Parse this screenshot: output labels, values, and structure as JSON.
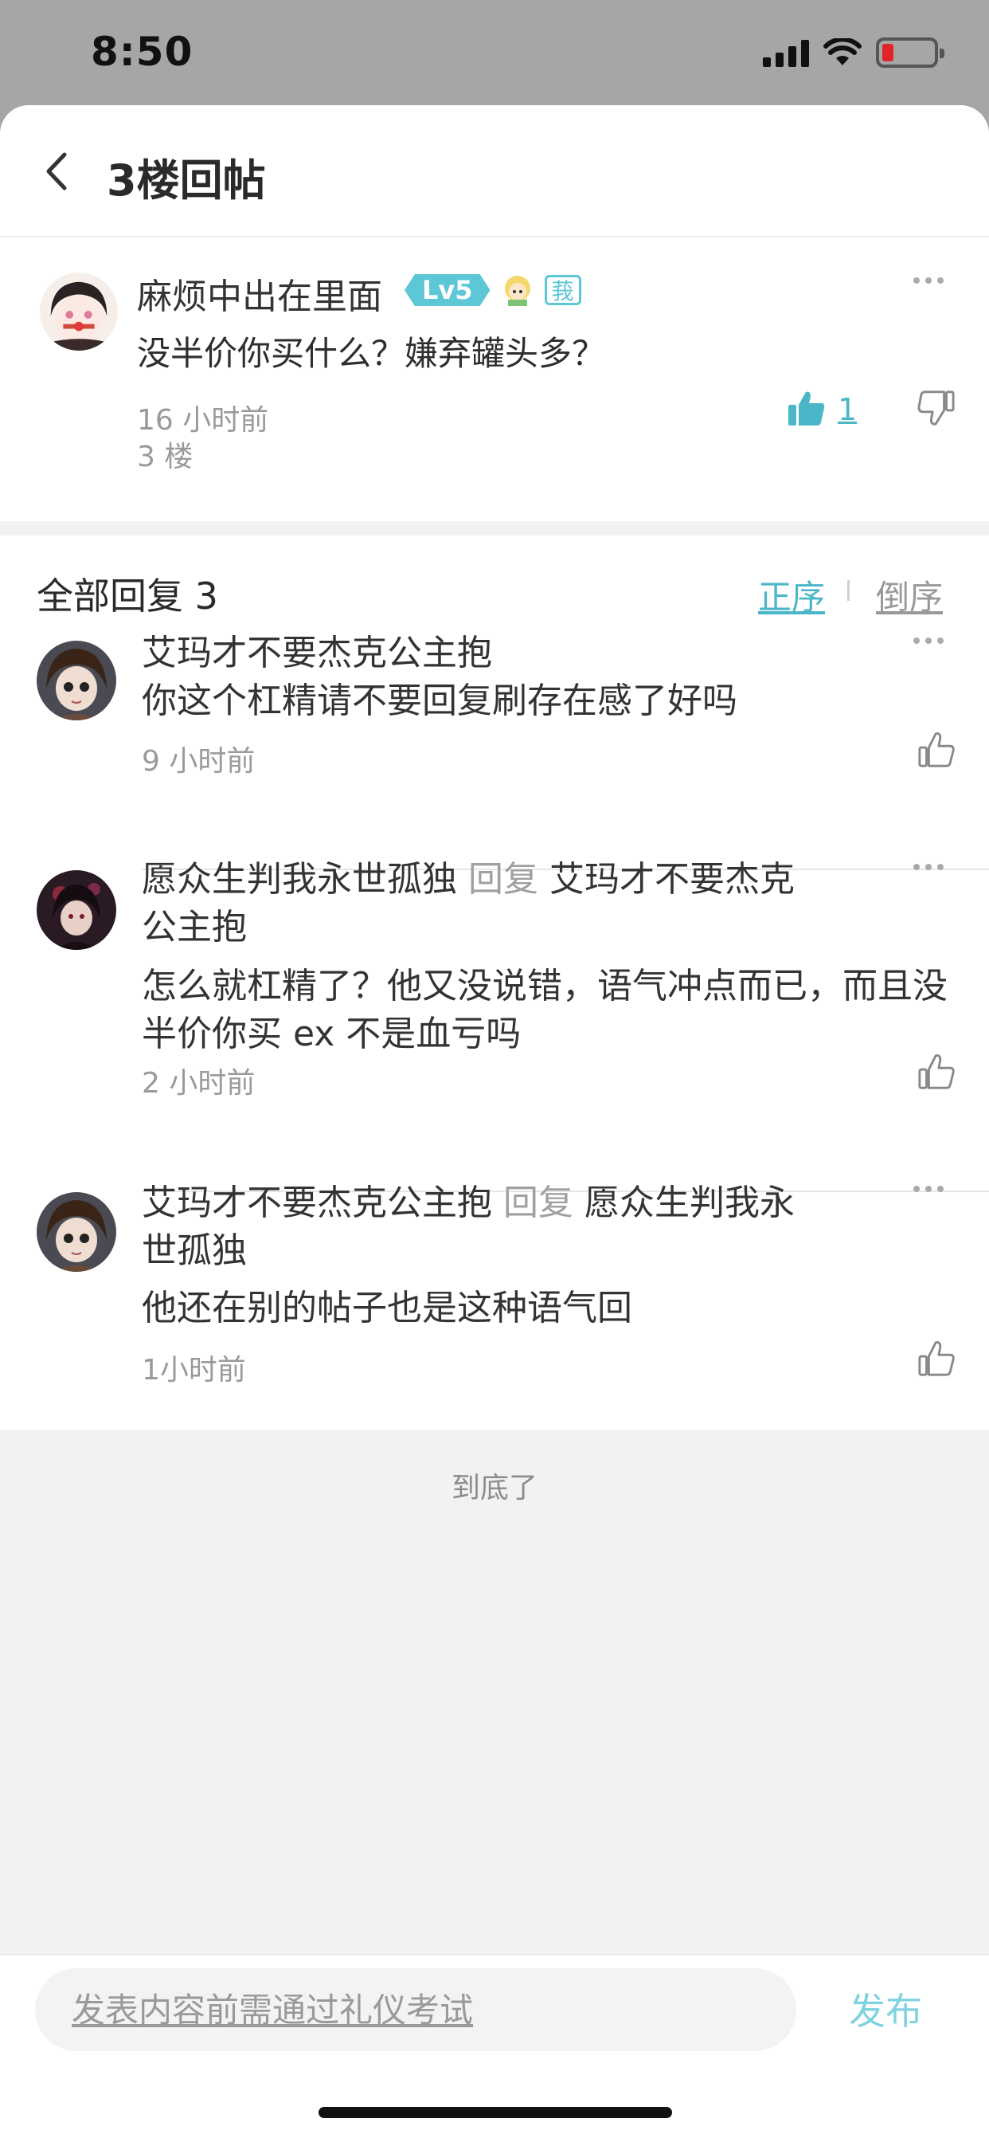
{
  "status_bar": {
    "time": "8:50",
    "battery_color": "#e0242a"
  },
  "header": {
    "title": "3楼回帖"
  },
  "main_post": {
    "username": "麻烦中出在里面",
    "level": "Lv5",
    "tag": "莪",
    "floor": "3 楼",
    "content": "没半价你买什么？嫌弃罐头多？",
    "time": "16 小时前",
    "like_count": "1"
  },
  "replies": {
    "title": "全部回复 3",
    "sort_asc": "正序",
    "sort_desc": "倒序",
    "items": [
      {
        "username": "艾玛才不要杰克公主抱",
        "reply_word": "",
        "reply_to": "",
        "content": "你这个杠精请不要回复刷存在感了好吗",
        "time": "9 小时前"
      },
      {
        "username": "愿众生判我永世孤独",
        "reply_word": "回复",
        "reply_to": "艾玛才不要杰克公主抱",
        "content": "怎么就杠精了？他又没说错，语气冲点而已，而且没半价你买 ex 不是血亏吗",
        "time": "2 小时前"
      },
      {
        "username": "艾玛才不要杰克公主抱",
        "reply_word": "回复",
        "reply_to": "愿众生判我永世孤独",
        "content": "他还在别的帖子也是这种语气回",
        "time": "1小时前"
      }
    ]
  },
  "footer": {
    "end_text": "到底了"
  },
  "bottom_bar": {
    "placeholder": "发表内容前需通过礼仪考试",
    "publish_label": "发布"
  },
  "colors": {
    "accent": "#4bb6c8",
    "level_badge": "#5ec7d6",
    "publish": "#7fd3df"
  },
  "icons": [
    "back-icon",
    "more-icon",
    "thumbs-up-icon",
    "thumbs-down-icon",
    "signal-icon",
    "wifi-icon",
    "battery-icon"
  ]
}
